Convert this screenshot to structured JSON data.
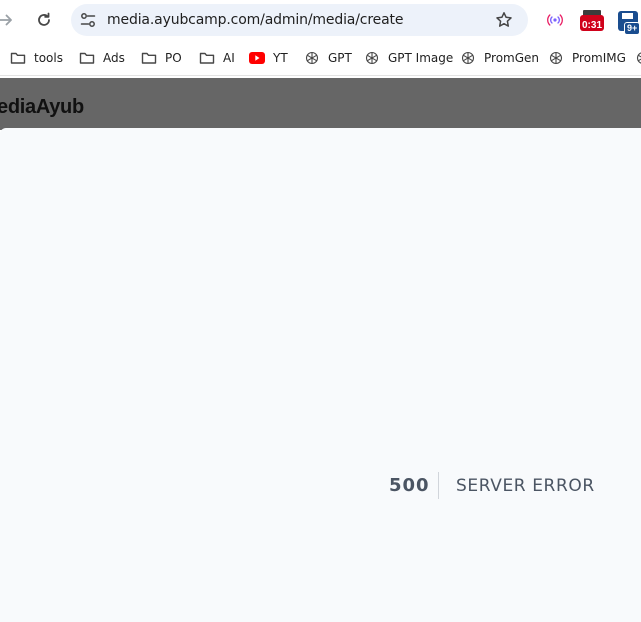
{
  "browser": {
    "url": "media.ayubcamp.com/admin/media/create",
    "extensions": [
      {
        "name": "broadcast-extension",
        "badge": ""
      },
      {
        "name": "timer-extension",
        "badge": "0:31"
      },
      {
        "name": "save-extension",
        "badge": "9+"
      }
    ]
  },
  "bookmarks": [
    {
      "label": "tools",
      "icon": "folder-icon"
    },
    {
      "label": "Ads",
      "icon": "folder-icon"
    },
    {
      "label": "PO",
      "icon": "folder-icon"
    },
    {
      "label": "AI",
      "icon": "folder-icon"
    },
    {
      "label": "YT",
      "icon": "youtube-icon"
    },
    {
      "label": "GPT",
      "icon": "openai-icon"
    },
    {
      "label": "GPT Image",
      "icon": "openai-icon"
    },
    {
      "label": "PromGen",
      "icon": "openai-icon"
    },
    {
      "label": "PromIMG",
      "icon": "openai-icon"
    }
  ],
  "app": {
    "brand": "ediaAyub"
  },
  "error": {
    "code": "500",
    "message": "SERVER ERROR"
  },
  "colors": {
    "header_bg": "#666666",
    "page_bg": "#f8fafc",
    "omnibox_bg": "#edf2fa",
    "error_text": "#4b5563",
    "timer_badge": "#d0021b",
    "save_badge": "#1a4d8f"
  }
}
